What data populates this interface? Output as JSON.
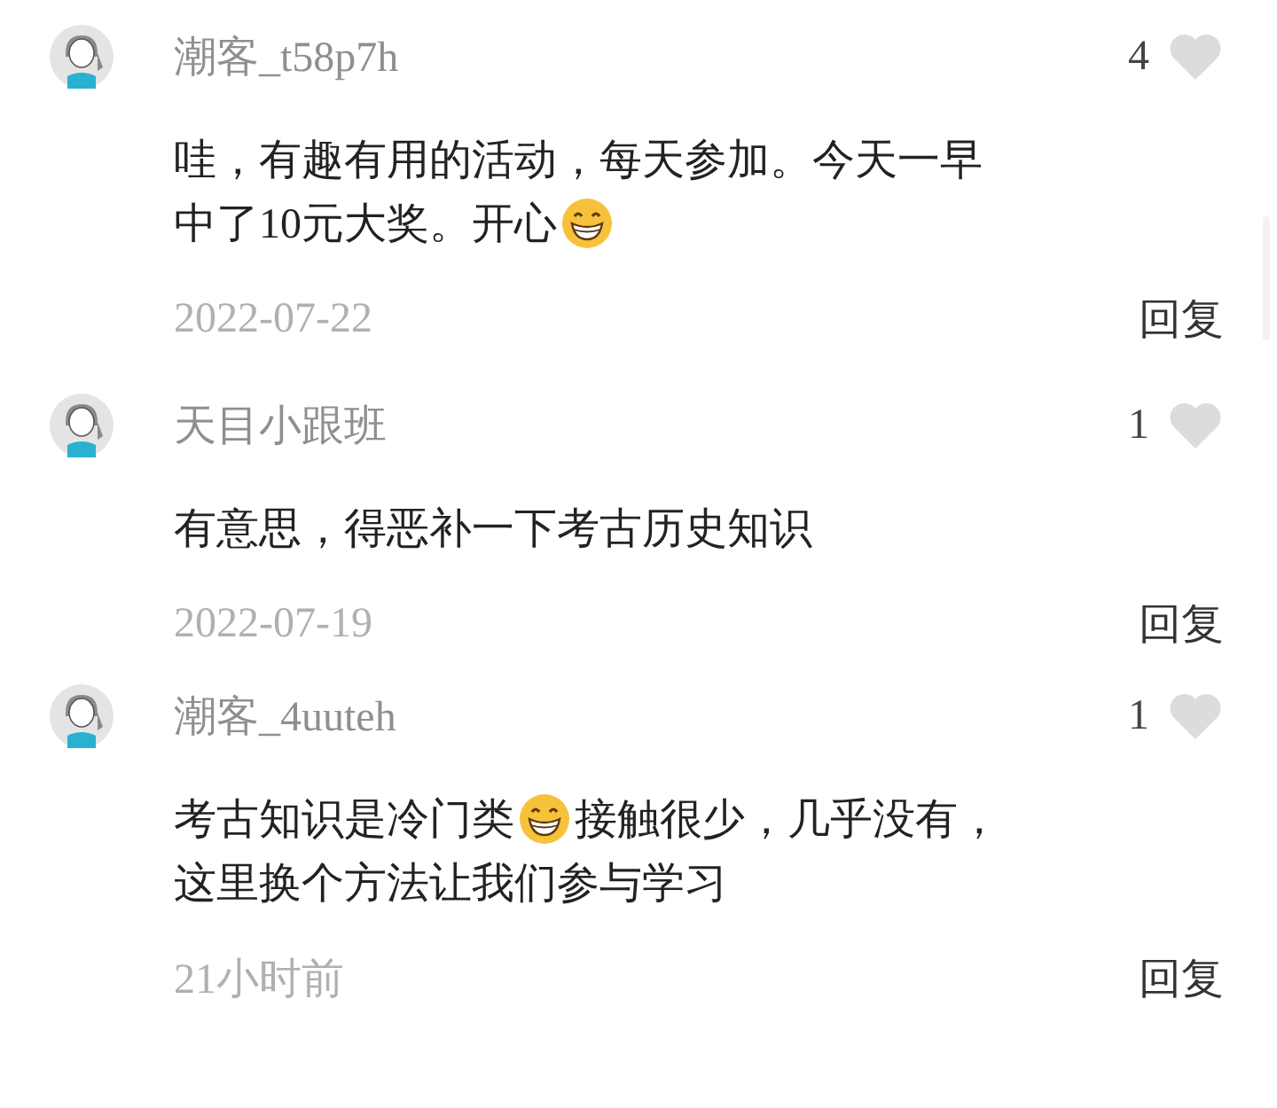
{
  "comments": [
    {
      "user": "潮客_t58p7h",
      "likes": "4",
      "liked": false,
      "lines": [
        [
          {
            "kind": "text",
            "text": "哇，有趣有用的活动，每天参加。今天一早"
          }
        ],
        [
          {
            "kind": "text",
            "text": "中了10元大奖。开心"
          },
          {
            "kind": "emoji"
          }
        ]
      ],
      "time": "2022-07-22",
      "reply": "回复"
    },
    {
      "user": "天目小跟班",
      "likes": "1",
      "liked": false,
      "lines": [
        [
          {
            "kind": "text",
            "text": "有意思，得恶补一下考古历史知识"
          }
        ]
      ],
      "time": "2022-07-19",
      "reply": "回复"
    },
    {
      "user": "潮客_4uuteh",
      "likes": "1",
      "liked": false,
      "lines": [
        [
          {
            "kind": "text",
            "text": "考古知识是冷门类"
          },
          {
            "kind": "emoji"
          },
          {
            "kind": "text",
            "text": "接触很少，几乎没有，"
          }
        ],
        [
          {
            "kind": "text",
            "text": "这里换个方法让我们参与学习"
          }
        ]
      ],
      "time": "21小时前",
      "reply": "回复"
    }
  ]
}
